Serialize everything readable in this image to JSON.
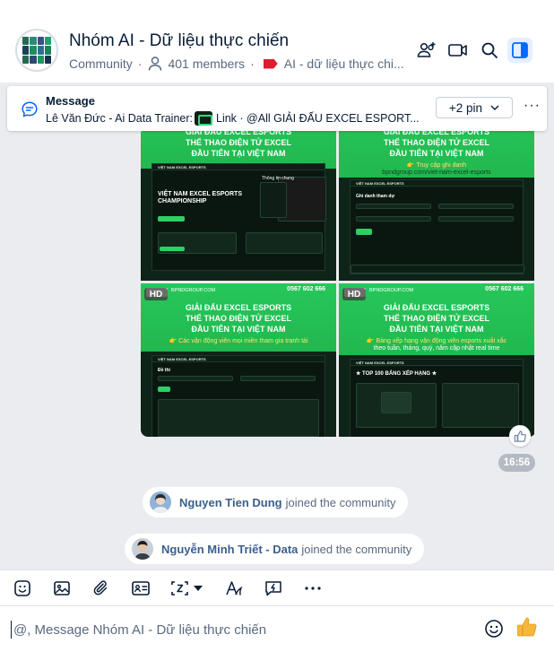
{
  "header": {
    "title": "Nhóm AI - Dữ liệu thực chiến",
    "type_label": "Community",
    "members": "401 members",
    "tag": "AI - dữ liệu thực chi...",
    "colors": {
      "tag": "#e01b2f",
      "active_bg": "#e5efff",
      "accent": "#0068ff"
    }
  },
  "pinned": {
    "title": "Message",
    "preview_sender": "Lê Văn Đức - Ai Data Trainer:",
    "preview_text": "Link · @All GIẢI ĐẤU EXCEL ESPORT...",
    "count": "+2 pin",
    "more": "···"
  },
  "images": [
    {
      "site": "",
      "phone": "",
      "hd": "",
      "line1": "GIẢI ĐẤU EXCEL ESPORTS",
      "line2": "THỂ THAO ĐIỆN TỬ EXCEL",
      "line3": "ĐẦU TIÊN TẠI VIỆT NAM",
      "yellow": "",
      "link": "",
      "screen_title": "VIỆT NAM EXCEL ESPORTS CHAMPIONSHIP",
      "side_title": "Thông tin chung"
    },
    {
      "site": "",
      "phone": "",
      "hd": "",
      "line1": "GIẢI ĐẤU EXCEL ESPORTS",
      "line2": "THỂ THAO ĐIỆN TỬ EXCEL",
      "line3": "ĐẦU TIÊN TẠI VIỆT NAM",
      "yellow": "👉 Truy cập ghi danh",
      "link": "bpndgroup.com/viet-nam-excel-esports",
      "screen_title": "Ghi danh tham dự",
      "side_title": ""
    },
    {
      "site": "BPNDGROUP.COM",
      "phone": "0567 602 666",
      "hd": "HD",
      "line1": "GIẢI ĐẤU EXCEL ESPORTS",
      "line2": "THỂ THAO ĐIỆN TỬ EXCEL",
      "line3": "ĐẦU TIÊN TẠI VIỆT NAM",
      "yellow": "👉 Các vận động viên mọi miền tham gia tranh tài",
      "link": "",
      "screen_title": "Đề thi",
      "side_title": ""
    },
    {
      "site": "BPNDGROUP.COM",
      "phone": "0567 602 666",
      "hd": "HD",
      "line1": "GIẢI ĐẤU EXCEL ESPORTS",
      "line2": "THỂ THAO ĐIỆN TỬ EXCEL",
      "line3": "ĐẦU TIÊN TẠI VIỆT NAM",
      "yellow": "👉 Bảng xếp hạng vận động viên esports xuất xắc",
      "yellow2": "theo tuần, tháng, quý, năm cập nhật real time",
      "link": "",
      "screen_title": "★ TOP 100 BẢNG XẾP HẠNG ★",
      "side_title": ""
    }
  ],
  "message_time": "16:56",
  "events": [
    {
      "name": "Nguyen Tien Dung",
      "action": "joined the community"
    },
    {
      "name": "Nguyễn Minh Triết - Data",
      "action": "joined the community"
    }
  ],
  "input": {
    "placeholder": "@, Message Nhóm AI - Dữ liệu thực chiến"
  }
}
